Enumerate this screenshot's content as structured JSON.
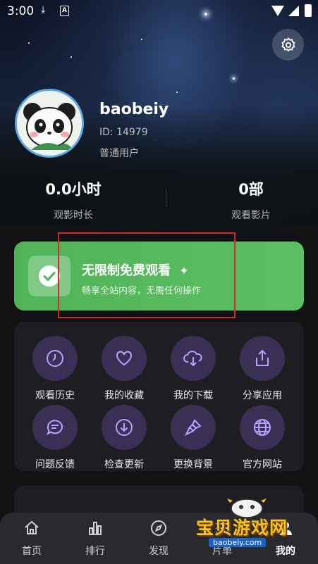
{
  "status_bar": {
    "time": "3:00",
    "download_icon": "download-icon",
    "app_badge": "A"
  },
  "profile": {
    "username": "baobeiy",
    "id_text": "ID: 14979",
    "user_type": "普通用户"
  },
  "stats": [
    {
      "value": "0.0小时",
      "label": "观影时长"
    },
    {
      "value": "0部",
      "label": "观看影片"
    }
  ],
  "promo": {
    "title": "无限制免费观看",
    "subtitle": "畅享全站内容，无需任何操作",
    "color": "#50b457"
  },
  "menu": [
    {
      "label": "观看历史",
      "icon": "clock-icon"
    },
    {
      "label": "我的收藏",
      "icon": "heart-icon"
    },
    {
      "label": "我的下载",
      "icon": "cloud-download-icon"
    },
    {
      "label": "分享应用",
      "icon": "share-icon"
    },
    {
      "label": "问题反馈",
      "icon": "chat-icon"
    },
    {
      "label": "检查更新",
      "icon": "arrow-down-circle-icon"
    },
    {
      "label": "更换背景",
      "icon": "brush-icon"
    },
    {
      "label": "官方网站",
      "icon": "globe-icon"
    }
  ],
  "bottom_nav": [
    {
      "label": "首页",
      "icon": "home-icon"
    },
    {
      "label": "排行",
      "icon": "chart-icon"
    },
    {
      "label": "发现",
      "icon": "compass-icon"
    },
    {
      "label": "片单",
      "icon": "list-icon"
    },
    {
      "label": "我的",
      "icon": "user-icon",
      "active": true
    }
  ],
  "watermark": {
    "text": "宝贝游戏网",
    "url": "baobeiy.com"
  },
  "colors": {
    "accent_purple": "#b9a2ff",
    "tile_bg": "#3a2f55",
    "card_bg": "#1e1d22"
  }
}
